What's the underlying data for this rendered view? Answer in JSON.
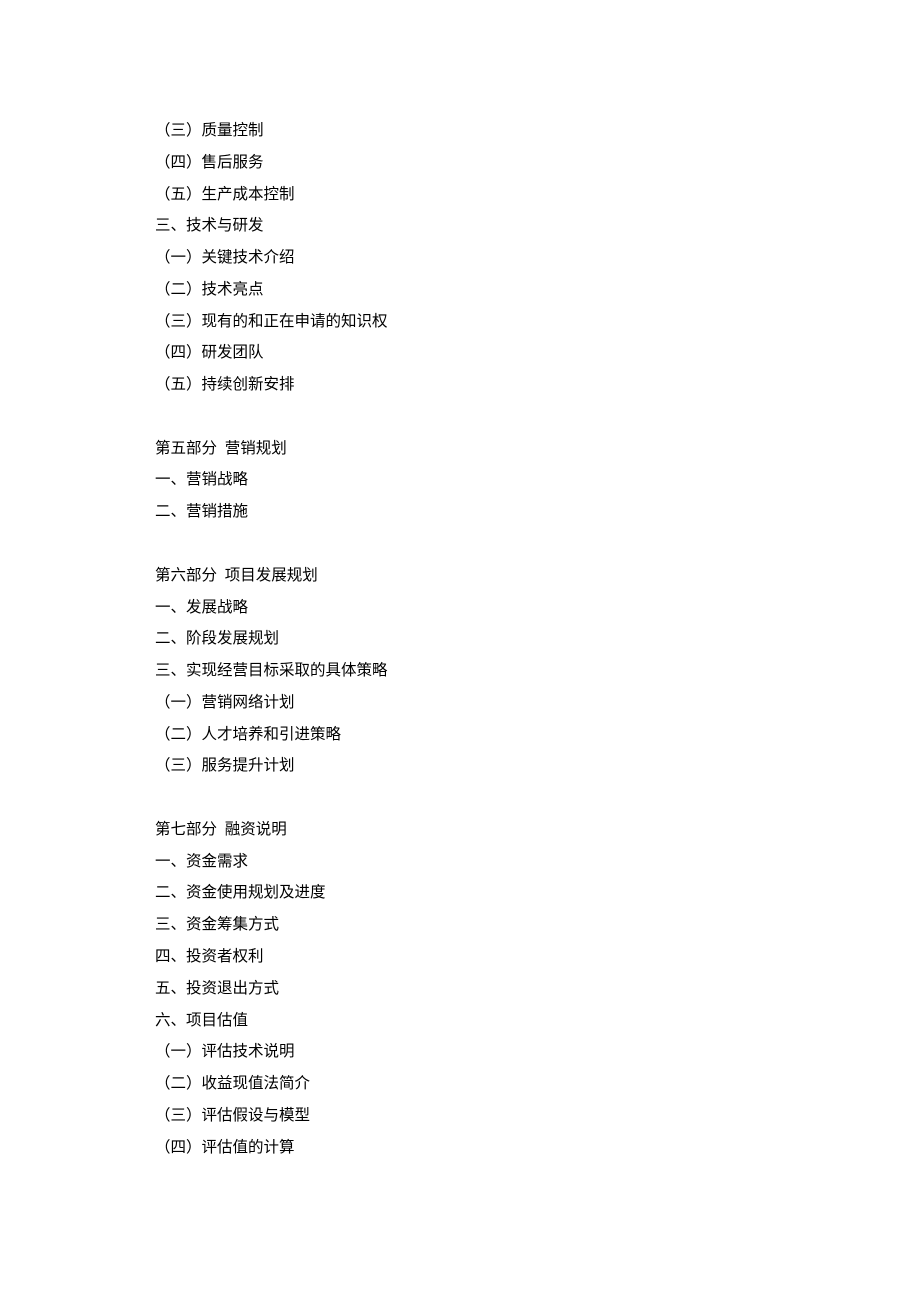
{
  "lines": [
    "（三）质量控制",
    "（四）售后服务",
    "（五）生产成本控制",
    "三、技术与研发",
    "（一）关键技术介绍",
    "（二）技术亮点",
    "（三）现有的和正在申请的知识权",
    "（四）研发团队",
    "（五）持续创新安排",
    "",
    "第五部分  营销规划",
    "一、营销战略",
    "二、营销措施",
    "",
    "第六部分  项目发展规划",
    "一、发展战略",
    "二、阶段发展规划",
    "三、实现经营目标采取的具体策略",
    "（一）营销网络计划",
    "（二）人才培养和引进策略",
    "（三）服务提升计划",
    "",
    "第七部分  融资说明",
    "一、资金需求",
    "二、资金使用规划及进度",
    "三、资金筹集方式",
    "四、投资者权利",
    "五、投资退出方式",
    "六、项目估值",
    "（一）评估技术说明",
    "（二）收益现值法简介",
    "（三）评估假设与模型",
    "（四）评估值的计算"
  ]
}
